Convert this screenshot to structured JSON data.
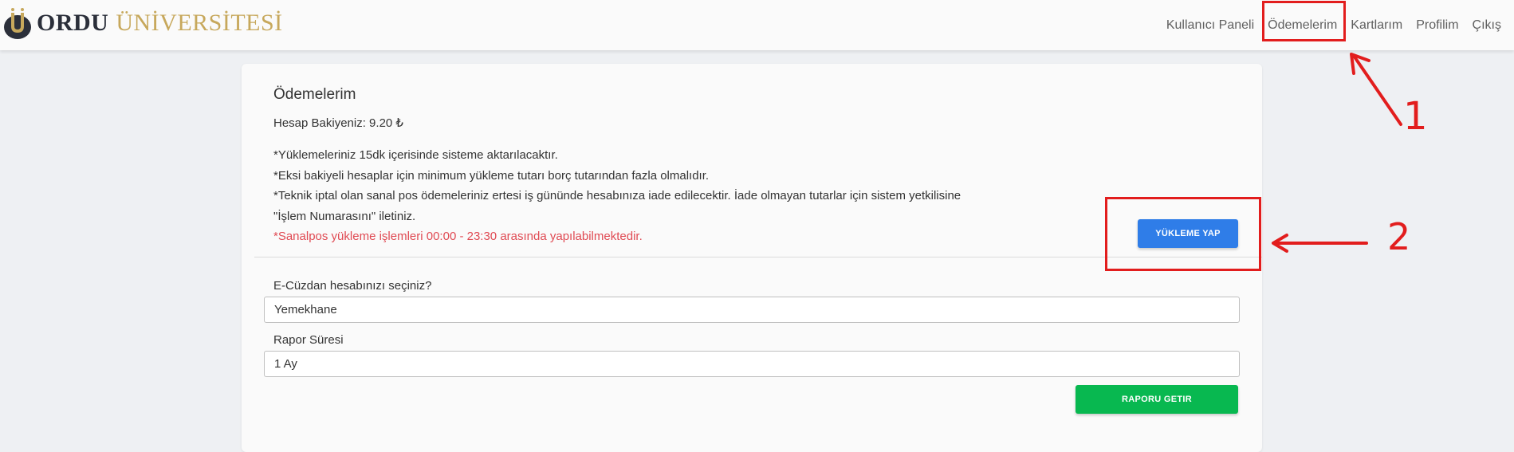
{
  "brand": {
    "name_bold": "ORDU",
    "name_light": "ÜNİVERSİTESİ"
  },
  "nav": {
    "items": [
      {
        "label": "Kullanıcı Paneli"
      },
      {
        "label": "Ödemelerim"
      },
      {
        "label": "Kartlarım"
      },
      {
        "label": "Profilim"
      },
      {
        "label": "Çıkış"
      }
    ]
  },
  "page": {
    "title": "Ödemelerim",
    "balance": "Hesap Bakiyeniz: 9.20 ₺",
    "notes": [
      "*Yüklemeleriniz 15dk içerisinde sisteme aktarılacaktır.",
      "*Eksi bakiyeli hesaplar için minimum yükleme tutarı borç tutarından fazla olmalıdır.",
      "*Teknik iptal olan sanal pos ödemeleriniz ertesi iş gününde hesabınıza iade edilecektir. İade olmayan tutarlar için sistem yetkilisine \"İşlem Numarasını\" iletiniz."
    ],
    "warning": "*Sanalpos yükleme işlemleri 00:00 - 23:30 arasında yapılabilmektedir.",
    "topup_button": "YÜKLEME YAP",
    "wallet_label": "E-Cüzdan hesabınızı seçiniz?",
    "wallet_value": "Yemekhane",
    "period_label": "Rapor Süresi",
    "period_value": "1 Ay",
    "report_button": "RAPORU GETIR"
  },
  "annotations": {
    "marker_1": "1",
    "marker_2": "2",
    "color": "#e21d1d"
  }
}
